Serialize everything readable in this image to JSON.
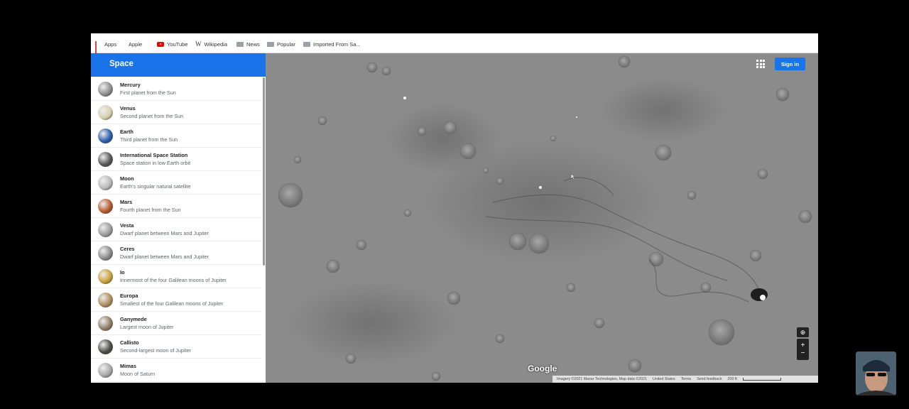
{
  "bookmarks": [
    {
      "label": "Apps",
      "icon": "apps-grid-icon"
    },
    {
      "label": "Apple",
      "icon": "apple-icon"
    },
    {
      "label": "YouTube",
      "icon": "youtube-icon"
    },
    {
      "label": "Wikipedia",
      "icon": "wikipedia-icon"
    },
    {
      "label": "News",
      "icon": "folder-icon"
    },
    {
      "label": "Popular",
      "icon": "folder-icon"
    },
    {
      "label": "Imported From Sa...",
      "icon": "folder-icon"
    }
  ],
  "sidebar": {
    "title": "Space",
    "collapse_glyph": "◂",
    "items": [
      {
        "name": "Mercury",
        "desc": "First planet from the Sun",
        "color": "#8d8d8d"
      },
      {
        "name": "Venus",
        "desc": "Second planet from the Sun",
        "color": "#d8cfae"
      },
      {
        "name": "Earth",
        "desc": "Third planet from the Sun",
        "color": "#2a5caa"
      },
      {
        "name": "International Space Station",
        "desc": "Space station in low Earth orbit",
        "color": "#555555"
      },
      {
        "name": "Moon",
        "desc": "Earth's singular natural satellite",
        "color": "#b9b9b9"
      },
      {
        "name": "Mars",
        "desc": "Fourth planet from the Sun",
        "color": "#b5572b"
      },
      {
        "name": "Vesta",
        "desc": "Dwarf planet between Mars and Jupiter",
        "color": "#9b9b9b"
      },
      {
        "name": "Ceres",
        "desc": "Dwarf planet between Mars and Jupiter",
        "color": "#8a8a8a"
      },
      {
        "name": "Io",
        "desc": "Innermost of the four Galilean moons of Jupiter",
        "color": "#c9a03a"
      },
      {
        "name": "Europa",
        "desc": "Smallest of the four Galilean moons of Jupiter",
        "color": "#b08a5a"
      },
      {
        "name": "Ganymede",
        "desc": "Largest moon of Jupiter",
        "color": "#8e7c66"
      },
      {
        "name": "Callisto",
        "desc": "Second-largest moon of Jupiter",
        "color": "#4a4a45"
      },
      {
        "name": "Mimas",
        "desc": "Moon of Saturn",
        "color": "#a7a7a7"
      }
    ]
  },
  "map": {
    "sign_in": "Sign in",
    "zoom_in": "+",
    "zoom_out": "−",
    "logo": "Google",
    "attribution": "Imagery ©2021 Maxar Technologies, Map data ©2021",
    "region": "United States",
    "terms": "Terms",
    "feedback": "Send feedback",
    "scale": "200 ft"
  }
}
